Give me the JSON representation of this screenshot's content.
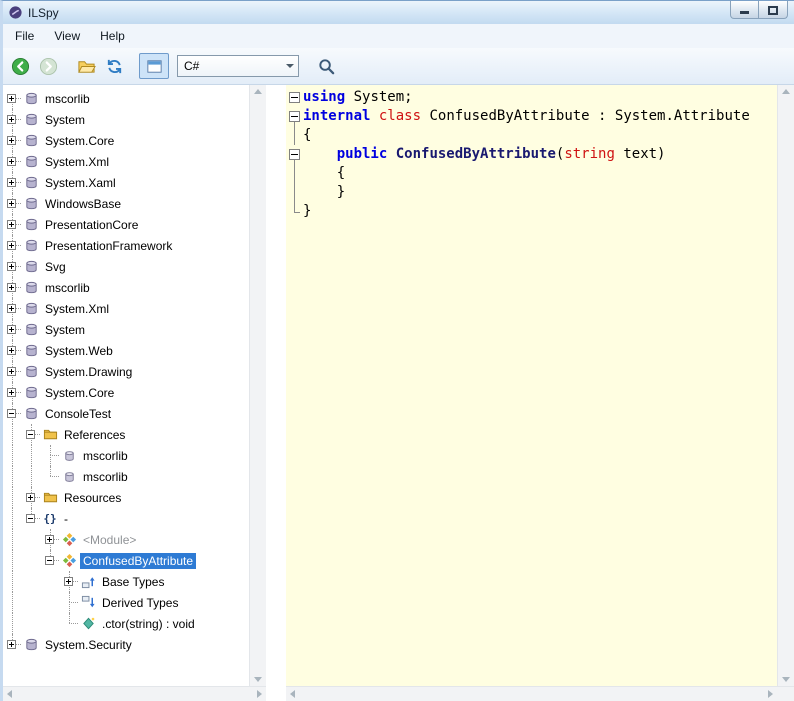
{
  "window": {
    "title": "ILSpy"
  },
  "titlebar": {
    "controls": [
      "minimize",
      "maximize"
    ]
  },
  "menu": {
    "items": [
      "File",
      "View",
      "Help"
    ]
  },
  "toolbar": {
    "language_selector": {
      "value": "C#"
    },
    "icons": {
      "back": "circle-arrow-left",
      "forward": "circle-arrow-right",
      "open": "folder-open",
      "refresh": "circular-arrows",
      "toggle": "window",
      "search": "magnifier",
      "dropdown": "chevron-down"
    }
  },
  "tree": {
    "items": [
      {
        "level": 0,
        "expander": "plus",
        "icon": "assembly",
        "label": "mscorlib"
      },
      {
        "level": 0,
        "expander": "plus",
        "icon": "assembly",
        "label": "System"
      },
      {
        "level": 0,
        "expander": "plus",
        "icon": "assembly",
        "label": "System.Core"
      },
      {
        "level": 0,
        "expander": "plus",
        "icon": "assembly",
        "label": "System.Xml"
      },
      {
        "level": 0,
        "expander": "plus",
        "icon": "assembly",
        "label": "System.Xaml"
      },
      {
        "level": 0,
        "expander": "plus",
        "icon": "assembly",
        "label": "WindowsBase"
      },
      {
        "level": 0,
        "expander": "plus",
        "icon": "assembly",
        "label": "PresentationCore"
      },
      {
        "level": 0,
        "expander": "plus",
        "icon": "assembly",
        "label": "PresentationFramework"
      },
      {
        "level": 0,
        "expander": "plus",
        "icon": "assembly",
        "label": "Svg"
      },
      {
        "level": 0,
        "expander": "plus",
        "icon": "assembly",
        "label": "mscorlib"
      },
      {
        "level": 0,
        "expander": "plus",
        "icon": "assembly",
        "label": "System.Xml"
      },
      {
        "level": 0,
        "expander": "plus",
        "icon": "assembly",
        "label": "System"
      },
      {
        "level": 0,
        "expander": "plus",
        "icon": "assembly",
        "label": "System.Web"
      },
      {
        "level": 0,
        "expander": "plus",
        "icon": "assembly",
        "label": "System.Drawing"
      },
      {
        "level": 0,
        "expander": "plus",
        "icon": "assembly",
        "label": "System.Core"
      },
      {
        "level": 0,
        "expander": "minus",
        "icon": "assembly",
        "label": "ConsoleTest"
      },
      {
        "level": 1,
        "expander": "minus",
        "icon": "folder",
        "label": "References"
      },
      {
        "level": 2,
        "expander": null,
        "icon": "assembly-ref",
        "label": "mscorlib"
      },
      {
        "level": 2,
        "expander": null,
        "icon": "assembly-ref",
        "label": "mscorlib"
      },
      {
        "level": 1,
        "expander": "plus",
        "icon": "folder",
        "label": "Resources"
      },
      {
        "level": 1,
        "expander": "minus",
        "icon": "namespace",
        "label": "-"
      },
      {
        "level": 2,
        "expander": "plus",
        "icon": "class",
        "label": "<Module>",
        "dim": true
      },
      {
        "level": 2,
        "expander": "minus",
        "icon": "class",
        "label": "ConfusedByAttribute",
        "selected": true
      },
      {
        "level": 3,
        "expander": "plus",
        "icon": "base-types",
        "label": "Base Types"
      },
      {
        "level": 3,
        "expander": null,
        "icon": "derived-types",
        "label": "Derived Types"
      },
      {
        "level": 3,
        "expander": null,
        "icon": "method",
        "label": ".ctor(string) : void"
      },
      {
        "level": 0,
        "expander": "plus",
        "icon": "assembly",
        "label": "System.Security"
      }
    ]
  },
  "code": {
    "lines": [
      {
        "fold": "box",
        "tokens": [
          {
            "text": "using",
            "style": "keyword"
          },
          {
            "text": " System;",
            "style": "plain"
          }
        ]
      },
      {
        "fold": "box",
        "tokens": [
          {
            "text": "internal",
            "style": "keyword"
          },
          {
            "text": " ",
            "style": "plain"
          },
          {
            "text": "class",
            "style": "type"
          },
          {
            "text": " ConfusedByAttribute : System.Attribute",
            "style": "plain"
          }
        ]
      },
      {
        "fold": "line",
        "tokens": [
          {
            "text": "{",
            "style": "plain"
          }
        ]
      },
      {
        "fold": "box",
        "tokens": [
          {
            "text": "    ",
            "style": "plain"
          },
          {
            "text": "public",
            "style": "keyword"
          },
          {
            "text": " ",
            "style": "plain"
          },
          {
            "text": "ConfusedByAttribute",
            "style": "method"
          },
          {
            "text": "(",
            "style": "plain"
          },
          {
            "text": "string",
            "style": "type"
          },
          {
            "text": " text)",
            "style": "plain"
          }
        ]
      },
      {
        "fold": "line",
        "tokens": [
          {
            "text": "    {",
            "style": "plain"
          }
        ]
      },
      {
        "fold": "line",
        "tokens": [
          {
            "text": "    }",
            "style": "plain"
          }
        ]
      },
      {
        "fold": "end",
        "tokens": [
          {
            "text": "}",
            "style": "plain"
          }
        ]
      }
    ]
  },
  "colors": {
    "selection": "#2e7bd4",
    "code_background": "#fffee1",
    "keyword": "#0000e0",
    "type_keyword": "#cf1212",
    "method_name": "#191970",
    "dim_text": "#8f9296"
  }
}
